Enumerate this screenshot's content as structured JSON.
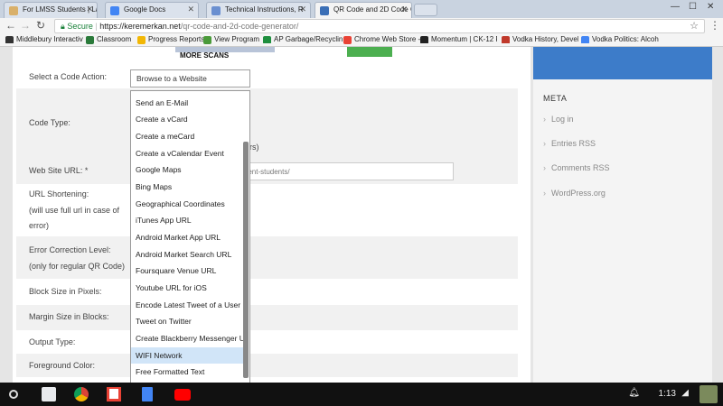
{
  "browser": {
    "tabs": [
      {
        "label": "For LMSS Students | La",
        "color": "#d9b06a"
      },
      {
        "label": "Google Docs",
        "color": "#4285f4"
      },
      {
        "label": "Technical Instructions, R",
        "color": "#6a8fd0"
      },
      {
        "label": "QR Code and 2D Code G",
        "color": "#3b6fb6"
      }
    ],
    "secure_label": "Secure",
    "url_host": "https://keremerkan.net",
    "url_path": "/qr-code-and-2d-code-generator/"
  },
  "bookmarks": [
    {
      "label": "Middlebury Interactiv",
      "color": "#333333"
    },
    {
      "label": "Classroom",
      "color": "#2a7a3a"
    },
    {
      "label": "Progress Reports",
      "color": "#f2b705"
    },
    {
      "label": "View Program",
      "color": "#4a9a3a"
    },
    {
      "label": "AP Garbage/Recyclin",
      "color": "#1e8e3e"
    },
    {
      "label": "Chrome Web Store -",
      "color": "#e94235"
    },
    {
      "label": "Momentum | CK-12 Fo",
      "color": "#222222"
    },
    {
      "label": "Vodka History, Devel",
      "color": "#c0392b"
    },
    {
      "label": "Vodka Politics: Alcoh",
      "color": "#4285f4"
    }
  ],
  "banner_text": "MORE SCANS",
  "form": {
    "code_action_label": "Select a Code Action:",
    "code_action_value": "Browse to a Website",
    "code_type_label": "Code Type:",
    "code_type_fragment": "rs)",
    "website_label": "Web Site URL: *",
    "website_value": "rrent-students/",
    "shortening_label": "URL Shortening:",
    "shortening_sub1": "(will use full url in case of",
    "shortening_sub2": "error)",
    "error_label": "Error Correction Level:",
    "error_sub": "(only for regular QR Code)",
    "block_label": "Block Size in Pixels:",
    "margin_label": "Margin Size in Blocks:",
    "output_label": "Output Type:",
    "fg_label": "Foreground Color:"
  },
  "dropdown": {
    "options": [
      "Send an E-Mail",
      "Create a vCard",
      "Create a meCard",
      "Create a vCalendar Event",
      "Google Maps",
      "Bing Maps",
      "Geographical Coordinates",
      "iTunes App URL",
      "Android Market App URL",
      "Android Market Search URL",
      "Foursquare Venue URL",
      "Youtube URL for iOS",
      "Encode Latest Tweet of a User",
      "Tweet on Twitter",
      "Create Blackberry Messenger User",
      "WIFI Network",
      "Free Formatted Text"
    ],
    "selected": "WIFI Network"
  },
  "sidebar": {
    "title": "META",
    "links": [
      "Log in",
      "Entries RSS",
      "Comments RSS",
      "WordPress.org"
    ]
  },
  "taskbar": {
    "time": "1:13",
    "apps": [
      {
        "icon": "files-app-icon",
        "color": "#e8eaed"
      },
      {
        "icon": "chrome-icon",
        "color": "#db4437"
      },
      {
        "icon": "gmail-icon",
        "color": "#e94235"
      },
      {
        "icon": "google-docs-icon",
        "color": "#4285f4"
      },
      {
        "icon": "youtube-icon",
        "color": "#ff0000"
      }
    ]
  }
}
